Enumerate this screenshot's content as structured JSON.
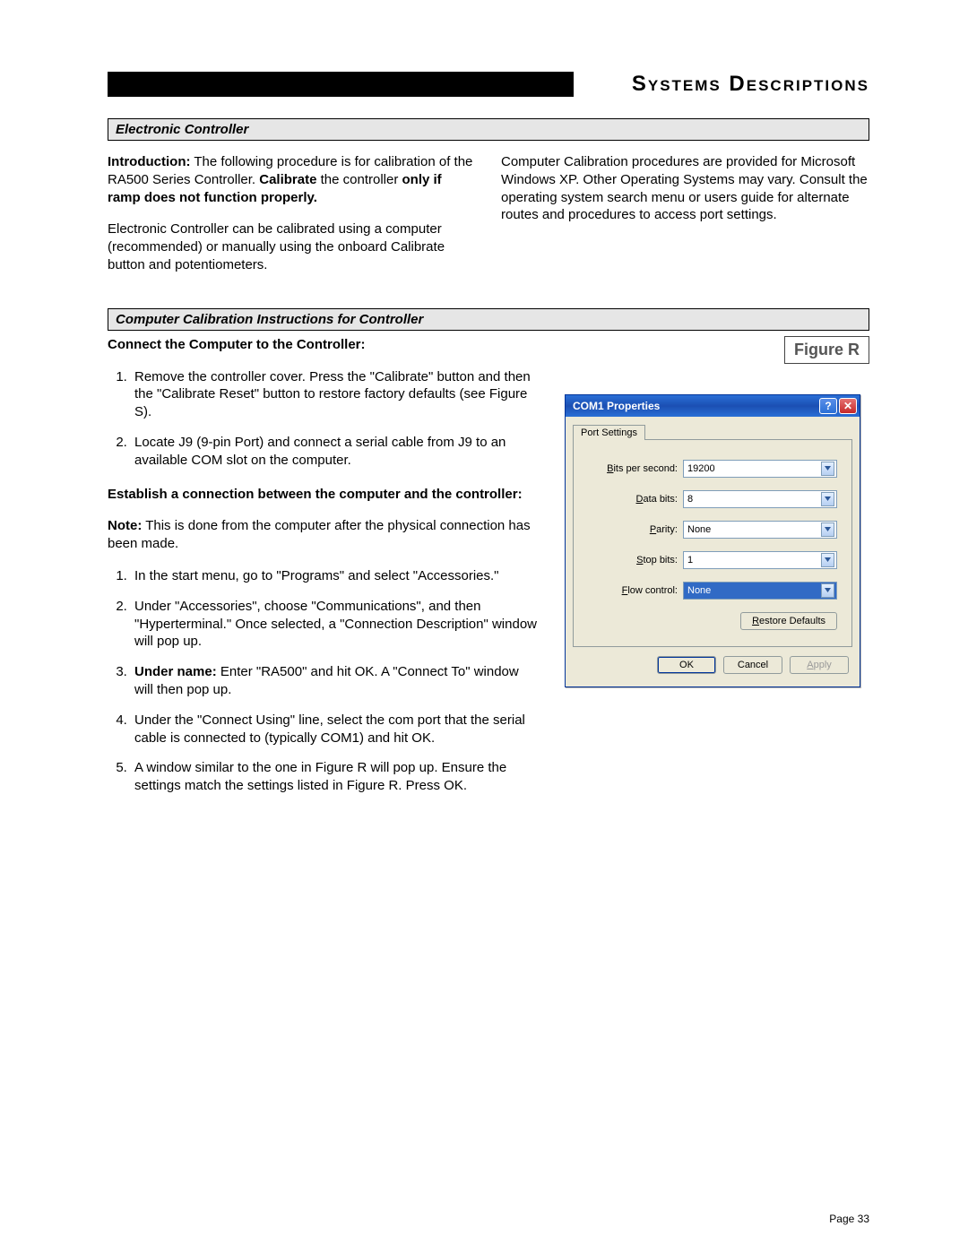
{
  "pageTitle": "Systems Descriptions",
  "section1": {
    "heading": "Electronic Controller"
  },
  "intro": {
    "label": "Introduction:",
    "p1a": "  The following procedure is for calibration of the RA500 Series Controller.  ",
    "calibrateWord": "Calibrate",
    "p1b": " the controller ",
    "boldPhrase": "only if ramp does not function properly.",
    "p2": "Electronic Controller can be calibrated using a computer (recommended) or manually using the onboard Calibrate button and potentiometers.",
    "rightCol": "Computer Calibration procedures are provided for Microsoft Windows XP.  Other Operating Systems may vary.  Consult the operating system search menu or users guide for alternate routes and procedures to access port settings."
  },
  "section2": {
    "heading": "Computer Calibration Instructions for Controller"
  },
  "connectHeading": "Connect the Computer to the Controller:",
  "connectSteps": [
    "Remove the controller cover.  Press the \"Calibrate\" button and then the \"Calibrate Reset\" button to restore factory defaults (see Figure S).",
    "Locate J9 (9-pin Port) and connect a serial cable from J9 to an available COM slot on the computer."
  ],
  "establishHeading": "Establish a connection between the computer and the controller:",
  "noteLabel": "Note:",
  "noteText": "  This is done from the computer after the physical connection has been made.",
  "establishSteps": {
    "s1": "In the start menu, go to \"Programs\" and select \"Accessories.\"",
    "s2": "Under \"Accessories\", choose \"Communications\", and then \"Hyperterminal.\"  Once selected, a \"Connection Description\" window will pop up.",
    "s3prefix": "Under name:",
    "s3rest": "  Enter \"RA500\" and hit OK.  A \"Connect To\" window will then pop up.",
    "s4": "Under the \"Connect Using\" line, select the com port that the serial cable is connected to (typically COM1) and hit OK.",
    "s5": "A window similar to the one in Figure R will pop up.  Ensure the settings match the settings listed in Figure R.  Press OK."
  },
  "figureLabel": "Figure R",
  "dialog": {
    "title": "COM1 Properties",
    "tab": "Port Settings",
    "fields": {
      "bits_per_second": {
        "label": "Bits per second:",
        "value": "19200"
      },
      "data_bits": {
        "label": "Data bits:",
        "value": "8"
      },
      "parity": {
        "label": "Parity:",
        "value": "None"
      },
      "stop_bits": {
        "label": "Stop bits:",
        "value": "1"
      },
      "flow_control": {
        "label": "Flow control:",
        "value": "None"
      }
    },
    "restore": "Restore Defaults",
    "ok": "OK",
    "cancel": "Cancel",
    "apply": "Apply"
  },
  "pageNumber": "Page 33"
}
